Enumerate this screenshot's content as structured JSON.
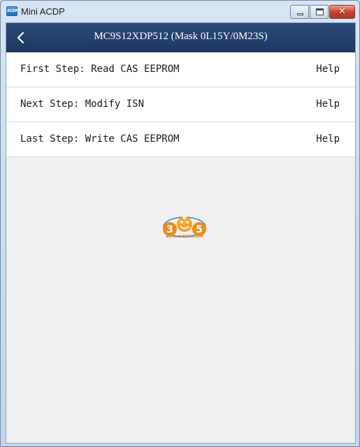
{
  "window": {
    "title": "Mini ACDP",
    "icon_text": "ACDP"
  },
  "header": {
    "title": "MC9S12XDP512 (Mask 0L15Y/0M23S)"
  },
  "steps": [
    {
      "label": "First Step: Read CAS EEPROM",
      "help": "Help"
    },
    {
      "label": "Next Step: Modify ISN",
      "help": "Help"
    },
    {
      "label": "Last Step: Write CAS EEPROM",
      "help": "Help"
    }
  ],
  "watermark": {
    "digits": [
      "3",
      "6",
      "5"
    ],
    "url": "www.obdii365.com"
  },
  "colors": {
    "header_bg": "#1f3a64",
    "row_bg": "#ffffff",
    "content_bg": "#f0f0f0",
    "logo_orange": "#f08a1c",
    "logo_blue": "#2a8fd8"
  }
}
